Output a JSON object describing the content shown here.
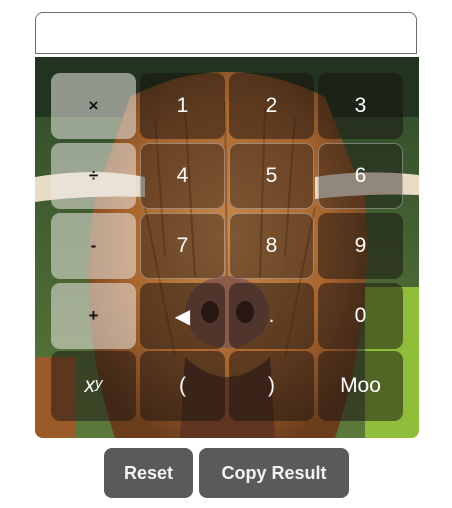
{
  "display": {
    "value": "",
    "placeholder": ""
  },
  "keypad": {
    "multiply": "×",
    "divide": "÷",
    "minus": "-",
    "plus": "+",
    "power_base": "x",
    "power_exp": "y",
    "k1": "1",
    "k2": "2",
    "k3": "3",
    "k4": "4",
    "k5": "5",
    "k6": "6",
    "k7": "7",
    "k8": "8",
    "k9": "9",
    "backspace": "◀",
    "dot": ".",
    "k0": "0",
    "open_paren": "(",
    "close_paren": ")",
    "moo": "Moo"
  },
  "actions": {
    "reset": "Reset",
    "copy": "Copy Result"
  },
  "colors": {
    "action_button": "#5a5a5a",
    "operator_key": "#ebe8e4",
    "number_key": "#191412"
  },
  "background_image": "highland-cow"
}
